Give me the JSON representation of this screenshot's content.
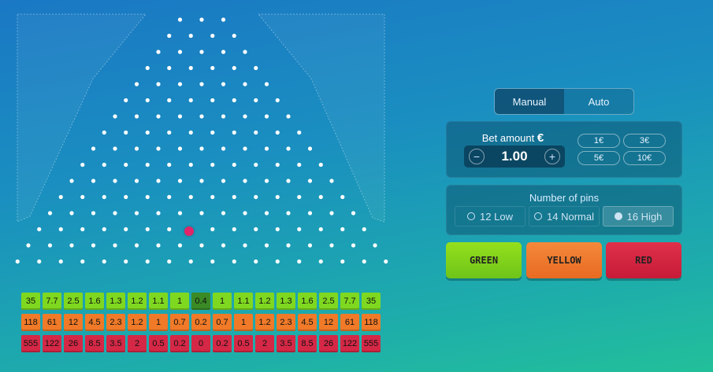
{
  "game": {
    "ball_color": "#e0256a",
    "rows": 16
  },
  "multipliers": {
    "green": [
      "35",
      "7.7",
      "2.5",
      "1.6",
      "1.3",
      "1.2",
      "1.1",
      "1",
      "0.4",
      "1",
      "1.1",
      "1.2",
      "1.3",
      "1.6",
      "2.5",
      "7.7",
      "35"
    ],
    "yellow": [
      "118",
      "61",
      "12",
      "4.5",
      "2.3",
      "1.2",
      "1",
      "0.7",
      "0.2",
      "0.7",
      "1",
      "1.2",
      "2.3",
      "4.5",
      "12",
      "61",
      "118"
    ],
    "red": [
      "555",
      "122",
      "26",
      "8.5",
      "3.5",
      "2",
      "0.5",
      "0.2",
      "0",
      "0.2",
      "0.5",
      "2",
      "3.5",
      "8.5",
      "26",
      "122",
      "555"
    ]
  },
  "mode_toggle": {
    "manual": "Manual",
    "auto": "Auto",
    "active": "Manual"
  },
  "bet": {
    "label": "Bet amount",
    "currency_symbol": "€",
    "minus": "−",
    "plus": "+",
    "amount": "1.00",
    "quick_amounts": [
      "1€",
      "3€",
      "5€",
      "10€"
    ]
  },
  "pins": {
    "label": "Number of pins",
    "options": [
      "12 Low",
      "14 Normal",
      "16 High"
    ],
    "selected": "16 High"
  },
  "buttons": {
    "green": "GREEN",
    "yellow": "YELLOW",
    "red": "RED"
  }
}
